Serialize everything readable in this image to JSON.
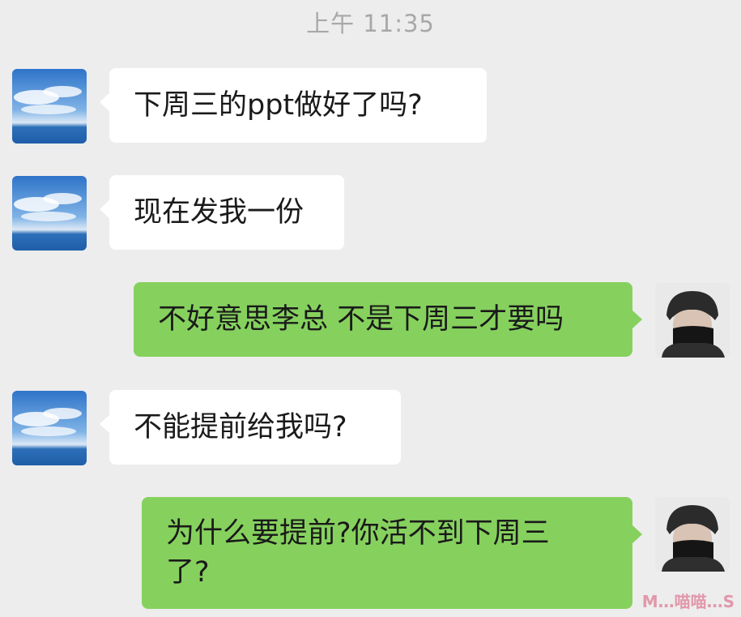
{
  "chat": {
    "timestamp": "上午 11:35",
    "messages": [
      {
        "side": "left",
        "text": "下周三的ppt做好了吗?"
      },
      {
        "side": "left",
        "text": "现在发我一份"
      },
      {
        "side": "right",
        "text": "不好意思李总 不是下周三才要吗"
      },
      {
        "side": "left",
        "text": "不能提前给我吗?"
      },
      {
        "side": "right",
        "text": "为什么要提前?你活不到下周三\n了?"
      }
    ]
  },
  "avatars": {
    "contact": "sky-sea-landscape-avatar",
    "self": "masked-man-avatar"
  },
  "watermark": {
    "text": "M…喵喵…S"
  },
  "colors": {
    "background": "#ededed",
    "sent_bubble": "#86d15e",
    "received_bubble": "#ffffff",
    "timestamp": "#a8a8a8"
  }
}
